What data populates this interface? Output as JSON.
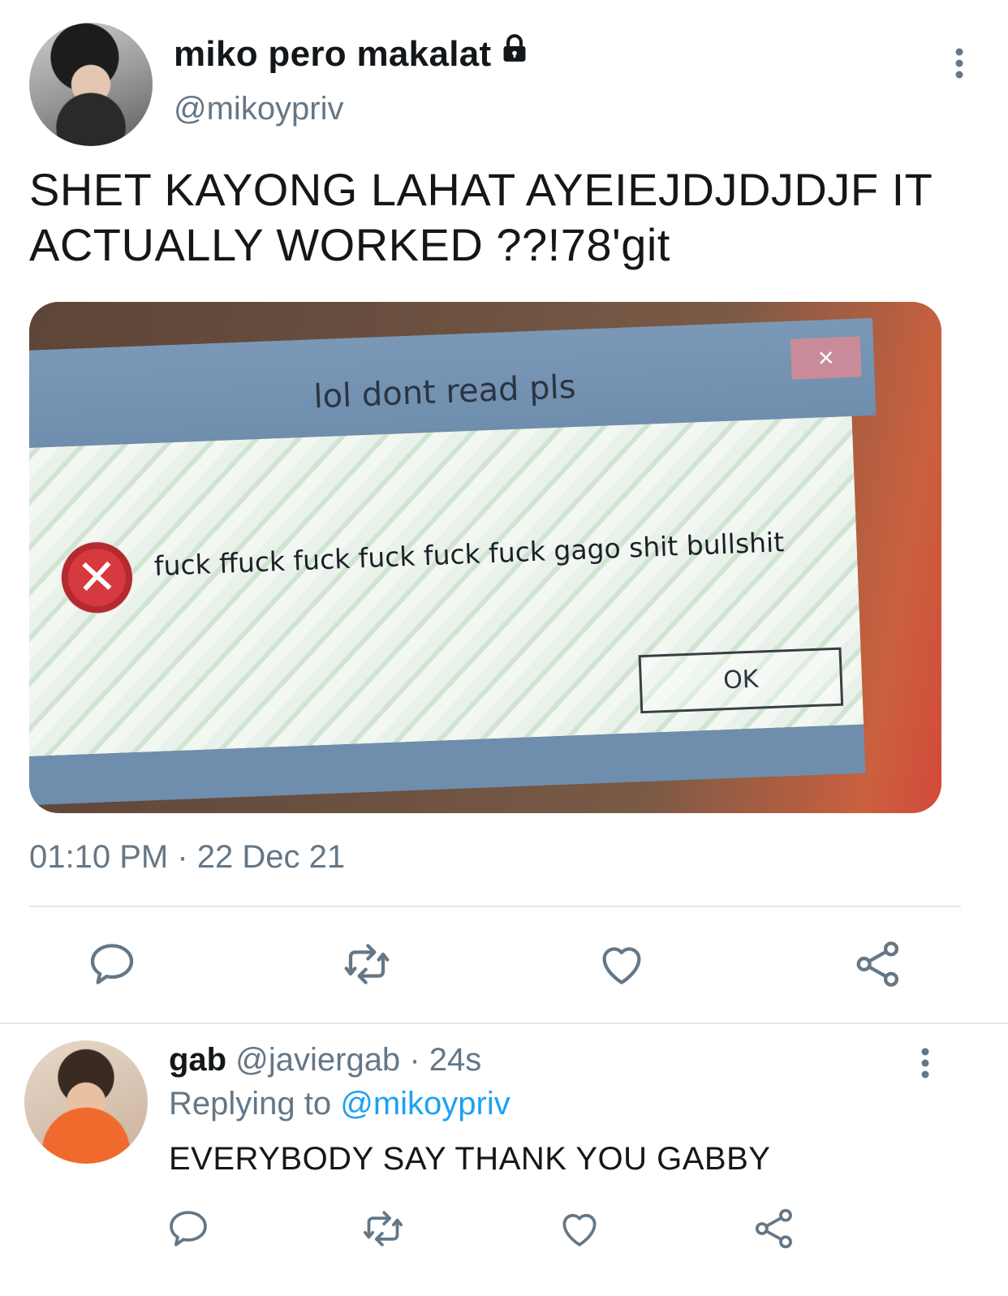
{
  "tweet": {
    "display_name": "miko pero makalat",
    "handle": "@mikoypriv",
    "text_line1": "SHET KAYONG LAHAT AYEIEJDJDJDJF IT",
    "text_line2": "ACTUALLY WORKED ??!78'git",
    "timestamp": "01:10 PM · 22 Dec 21",
    "media": {
      "dialog_title": "lol dont read pls",
      "dialog_close": "×",
      "dialog_message": "fuck ffuck fuck fuck fuck fuck gago shit  bullshit",
      "dialog_ok": "OK"
    }
  },
  "reply": {
    "display_name": "gab",
    "handle": "@javiergab",
    "time": "· 24s",
    "replying_prefix": "Replying to ",
    "replying_handle": "@mikoypriv",
    "text": "EVERYBODY SAY THANK YOU GABBY"
  },
  "icons": {
    "reply": "reply-icon",
    "retweet": "retweet-icon",
    "like": "heart-icon",
    "share": "share-icon",
    "lock": "lock-icon",
    "more": "more-vertical-icon"
  },
  "colors": {
    "text_primary": "#14171a",
    "text_secondary": "#657786",
    "link": "#1da1f2",
    "divider": "#e1e8ed"
  }
}
